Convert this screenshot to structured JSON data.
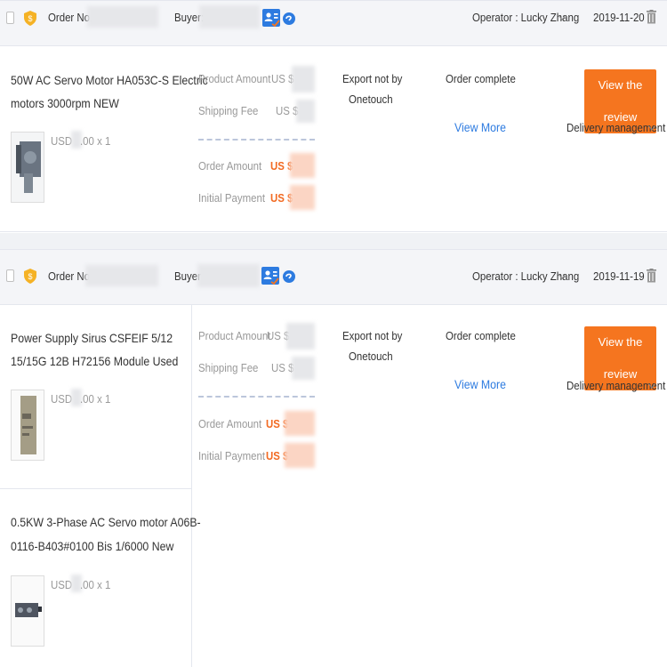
{
  "orders": [
    {
      "order_no_label": "Order No.",
      "buyer_label": "Buyer:",
      "operator": "Operator : Lucky Zhang",
      "date": "2019-11-20",
      "product_amount_label": "Product Amount",
      "product_amount_value": "US $",
      "shipping_fee_label": "Shipping Fee",
      "shipping_fee_value": "US $",
      "order_amount_label": "Order Amount",
      "order_amount_value": "US $",
      "initial_payment_label": "Initial Payment",
      "initial_payment_value": "US $",
      "export_status": [
        "Export not by",
        "Onetouch"
      ],
      "order_status": "Order complete",
      "view_more": "View More",
      "review_button": "View the review",
      "delivery_management": "Delivery management",
      "items": [
        {
          "title": [
            "50W AC Servo Motor HA053C-S Electric",
            "motors 3000rpm NEW"
          ],
          "price_prefix": "USD",
          "price_suffix": ".00 x 1"
        }
      ]
    },
    {
      "order_no_label": "Order No.",
      "buyer_label": "Buyer:",
      "operator": "Operator : Lucky Zhang",
      "date": "2019-11-19",
      "product_amount_label": "Product Amount",
      "product_amount_value": "US $",
      "shipping_fee_label": "Shipping Fee",
      "shipping_fee_value": "US $",
      "order_amount_label": "Order Amount",
      "order_amount_value": "US $",
      "initial_payment_label": "Initial Payment",
      "initial_payment_value": "US $",
      "export_status": [
        "Export not by",
        "Onetouch"
      ],
      "order_status": "Order complete",
      "view_more": "View More",
      "review_button": "View the review",
      "delivery_management": "Delivery management",
      "items": [
        {
          "title": [
            "Power Supply Sirus CSFEIF 5/12",
            "15/15G 12B H72156 Module Used"
          ],
          "price_prefix": "USD",
          "price_suffix": ".00 x 1"
        },
        {
          "title": [
            "0.5KW 3-Phase AC Servo motor A06B-",
            "0116-B403#0100 Bis 1/6000 New"
          ],
          "price_prefix": "USD",
          "price_suffix": ".00 x 1"
        }
      ]
    }
  ],
  "icons": {
    "checkbox": "checkbox-icon",
    "shield": "gold-shield-icon",
    "contact": "contact-card-icon",
    "chat": "chat-icon",
    "chevron": "chevron-down-icon",
    "trash": "trash-icon"
  },
  "colors": {
    "accent": "#f5751f",
    "link": "#2d7be0",
    "amount": "#f26a22",
    "header_bg": "#f4f5f8"
  }
}
